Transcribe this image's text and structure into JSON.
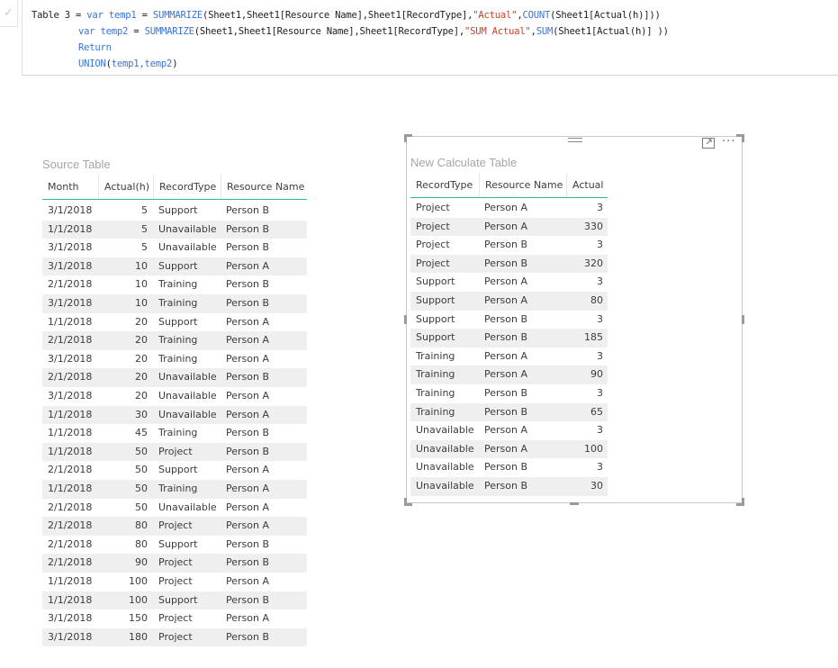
{
  "formula_bar": {
    "check_icon": "checkmark-icon",
    "check_glyph": "✓",
    "line1": {
      "a": "Table 3 = ",
      "b": "var",
      "c": " ",
      "d": "temp1",
      "e": " = ",
      "f": "SUMMARIZE",
      "g": "(Sheet1,Sheet1[Resource Name],Sheet1[RecordType],",
      "h": "\"Actual\"",
      "i": ",",
      "j": "COUNT",
      "k": "(Sheet1[Actual(h)]))"
    },
    "line2": {
      "b": "var",
      "c": " ",
      "d": "temp2",
      "e": " = ",
      "f": "SUMMARIZE",
      "g": "(Sheet1,Sheet1[Resource Name],Sheet1[RecordType],",
      "h": "\"SUM Actual\"",
      "i": ",",
      "j": "SUM",
      "k": "(Sheet1[Actual(h)] ))"
    },
    "line3": {
      "b": "Return"
    },
    "line4": {
      "f": "UNION",
      "g": "(",
      "d": "temp1,temp2",
      "k": ")"
    }
  },
  "source_table": {
    "title": "Source Table",
    "columns": [
      "Month",
      "Actual(h)",
      "RecordType",
      "Resource Name"
    ],
    "rows": [
      [
        "3/1/2018",
        "5",
        "Support",
        "Person B"
      ],
      [
        "1/1/2018",
        "5",
        "Unavailable",
        "Person B"
      ],
      [
        "3/1/2018",
        "5",
        "Unavailable",
        "Person B"
      ],
      [
        "3/1/2018",
        "10",
        "Support",
        "Person A"
      ],
      [
        "2/1/2018",
        "10",
        "Training",
        "Person B"
      ],
      [
        "3/1/2018",
        "10",
        "Training",
        "Person B"
      ],
      [
        "1/1/2018",
        "20",
        "Support",
        "Person A"
      ],
      [
        "2/1/2018",
        "20",
        "Training",
        "Person A"
      ],
      [
        "3/1/2018",
        "20",
        "Training",
        "Person A"
      ],
      [
        "2/1/2018",
        "20",
        "Unavailable",
        "Person B"
      ],
      [
        "3/1/2018",
        "20",
        "Unavailable",
        "Person A"
      ],
      [
        "1/1/2018",
        "30",
        "Unavailable",
        "Person A"
      ],
      [
        "1/1/2018",
        "45",
        "Training",
        "Person B"
      ],
      [
        "1/1/2018",
        "50",
        "Project",
        "Person B"
      ],
      [
        "2/1/2018",
        "50",
        "Support",
        "Person A"
      ],
      [
        "1/1/2018",
        "50",
        "Training",
        "Person A"
      ],
      [
        "2/1/2018",
        "50",
        "Unavailable",
        "Person A"
      ],
      [
        "2/1/2018",
        "80",
        "Project",
        "Person A"
      ],
      [
        "2/1/2018",
        "80",
        "Support",
        "Person B"
      ],
      [
        "2/1/2018",
        "90",
        "Project",
        "Person B"
      ],
      [
        "1/1/2018",
        "100",
        "Project",
        "Person A"
      ],
      [
        "1/1/2018",
        "100",
        "Support",
        "Person B"
      ],
      [
        "3/1/2018",
        "150",
        "Project",
        "Person A"
      ],
      [
        "3/1/2018",
        "180",
        "Project",
        "Person B"
      ]
    ]
  },
  "calc_table": {
    "title": "New Calculate Table",
    "columns": [
      "RecordType",
      "Resource Name",
      "Actual"
    ],
    "rows": [
      [
        "Project",
        "Person A",
        "3"
      ],
      [
        "Project",
        "Person A",
        "330"
      ],
      [
        "Project",
        "Person B",
        "3"
      ],
      [
        "Project",
        "Person B",
        "320"
      ],
      [
        "Support",
        "Person A",
        "3"
      ],
      [
        "Support",
        "Person A",
        "80"
      ],
      [
        "Support",
        "Person B",
        "3"
      ],
      [
        "Support",
        "Person B",
        "185"
      ],
      [
        "Training",
        "Person A",
        "3"
      ],
      [
        "Training",
        "Person A",
        "90"
      ],
      [
        "Training",
        "Person B",
        "3"
      ],
      [
        "Training",
        "Person B",
        "65"
      ],
      [
        "Unavailable",
        "Person A",
        "3"
      ],
      [
        "Unavailable",
        "Person A",
        "100"
      ],
      [
        "Unavailable",
        "Person B",
        "3"
      ],
      [
        "Unavailable",
        "Person B",
        "30"
      ]
    ],
    "icons": [
      "drag-grip-icon",
      "focus-mode-icon",
      "more-options-icon"
    ],
    "more_glyph": "···"
  },
  "colors": {
    "header_underline": "#33b8a8",
    "keyword": "#3a73d6",
    "string": "#c7432b",
    "row_alt": "#efefef"
  }
}
